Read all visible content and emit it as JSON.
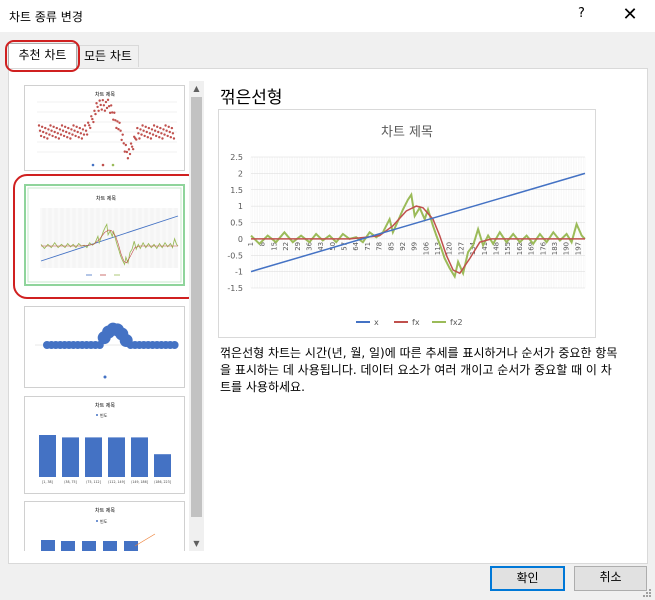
{
  "window": {
    "title": "차트 종류 변경",
    "help": "?",
    "close": "✕"
  },
  "tabs": [
    {
      "label": "추천 차트"
    },
    {
      "label": "모든 차트"
    }
  ],
  "thumbnails": [
    {
      "title": "차트 제목",
      "type": "scatter"
    },
    {
      "title": "차트 제목",
      "type": "line",
      "legend": [
        "x",
        "fx",
        "fx2"
      ]
    },
    {
      "title": "",
      "type": "scatter-bubble"
    },
    {
      "title": "차트 제목",
      "type": "bar",
      "legend": "빈도",
      "values": [
        35,
        33,
        33,
        33,
        33,
        19
      ],
      "categories": [
        "[1, 38]",
        "(38, 75]",
        "(75, 112]",
        "(112, 149]",
        "(149, 186]",
        "(186, 223]"
      ]
    },
    {
      "title": "차트 제목",
      "type": "pareto",
      "legend": "빈도"
    }
  ],
  "detail": {
    "title": "꺾은선형",
    "description": "꺾은선형 차트는 시간(년, 월, 일)에 따른 추세를 표시하거나 순서가 중요한 항목을 표시하는 데 사용됩니다. 데이터 요소가 여러 개이고 순서가 중요할 때 이 차트를 사용하세요."
  },
  "chart_data": {
    "type": "line",
    "title": "차트 제목",
    "ylim": [
      -1.5,
      2.5
    ],
    "yticks": [
      "2.5",
      "2",
      "1.5",
      "1",
      "0.5",
      "0",
      "-0.5",
      "-1",
      "-1.5"
    ],
    "xticks": [
      "1",
      "8",
      "15",
      "22",
      "29",
      "36",
      "43",
      "50",
      "57",
      "64",
      "71",
      "78",
      "85",
      "92",
      "99",
      "106",
      "113",
      "120",
      "127",
      "134",
      "141",
      "148",
      "155",
      "162",
      "169",
      "176",
      "183",
      "190",
      "197"
    ],
    "series": [
      {
        "name": "x",
        "color": "#4472c4",
        "points": [
          [
            1,
            -1.0
          ],
          [
            201,
            2.0
          ]
        ]
      },
      {
        "name": "fx",
        "color": "#c0504d",
        "points": [
          [
            1,
            0
          ],
          [
            60,
            0
          ],
          [
            70,
            0.05
          ],
          [
            78,
            0.1
          ],
          [
            86,
            0.4
          ],
          [
            94,
            0.85
          ],
          [
            100,
            1.0
          ],
          [
            104,
            0.95
          ],
          [
            110,
            0.6
          ],
          [
            114,
            0.1
          ],
          [
            118,
            -0.5
          ],
          [
            122,
            -0.95
          ],
          [
            126,
            -1.05
          ],
          [
            132,
            -0.6
          ],
          [
            138,
            -0.1
          ],
          [
            145,
            0
          ],
          [
            201,
            0
          ]
        ]
      },
      {
        "name": "fx2",
        "color": "#9bbb59",
        "points": [
          [
            1,
            0.1
          ],
          [
            6,
            -0.15
          ],
          [
            11,
            0.1
          ],
          [
            16,
            -0.1
          ],
          [
            21,
            0.2
          ],
          [
            26,
            -0.1
          ],
          [
            31,
            0.1
          ],
          [
            36,
            -0.1
          ],
          [
            40,
            0.15
          ],
          [
            44,
            -0.05
          ],
          [
            48,
            0.1
          ],
          [
            52,
            -0.1
          ],
          [
            56,
            0.15
          ],
          [
            60,
            0
          ],
          [
            64,
            0.05
          ],
          [
            68,
            -0.1
          ],
          [
            72,
            0.2
          ],
          [
            76,
            0.05
          ],
          [
            80,
            0.2
          ],
          [
            84,
            0.6
          ],
          [
            86,
            0.2
          ],
          [
            89,
            0.55
          ],
          [
            92,
            0.9
          ],
          [
            95,
            1.2
          ],
          [
            97,
            1.35
          ],
          [
            99,
            0.7
          ],
          [
            102,
            0.95
          ],
          [
            105,
            0.6
          ],
          [
            107,
            0.9
          ],
          [
            110,
            0.4
          ],
          [
            112,
            0.1
          ],
          [
            115,
            -0.3
          ],
          [
            117,
            -0.6
          ],
          [
            120,
            -0.9
          ],
          [
            123,
            -1.15
          ],
          [
            125,
            -0.7
          ],
          [
            128,
            -1.05
          ],
          [
            131,
            -0.4
          ],
          [
            134,
            -0.2
          ],
          [
            137,
            0.3
          ],
          [
            140,
            -0.2
          ],
          [
            143,
            0.1
          ],
          [
            146,
            -0.15
          ],
          [
            150,
            0.2
          ],
          [
            154,
            -0.1
          ],
          [
            158,
            0.15
          ],
          [
            162,
            -0.1
          ],
          [
            166,
            0.1
          ],
          [
            170,
            -0.15
          ],
          [
            174,
            0.15
          ],
          [
            178,
            -0.1
          ],
          [
            182,
            0.2
          ],
          [
            186,
            -0.05
          ],
          [
            190,
            0.15
          ],
          [
            193,
            -0.1
          ],
          [
            196,
            0.45
          ],
          [
            199,
            0.1
          ],
          [
            201,
            0.0
          ]
        ]
      }
    ],
    "legend_position": "bottom"
  },
  "buttons": {
    "ok": "확인",
    "cancel": "취소"
  }
}
